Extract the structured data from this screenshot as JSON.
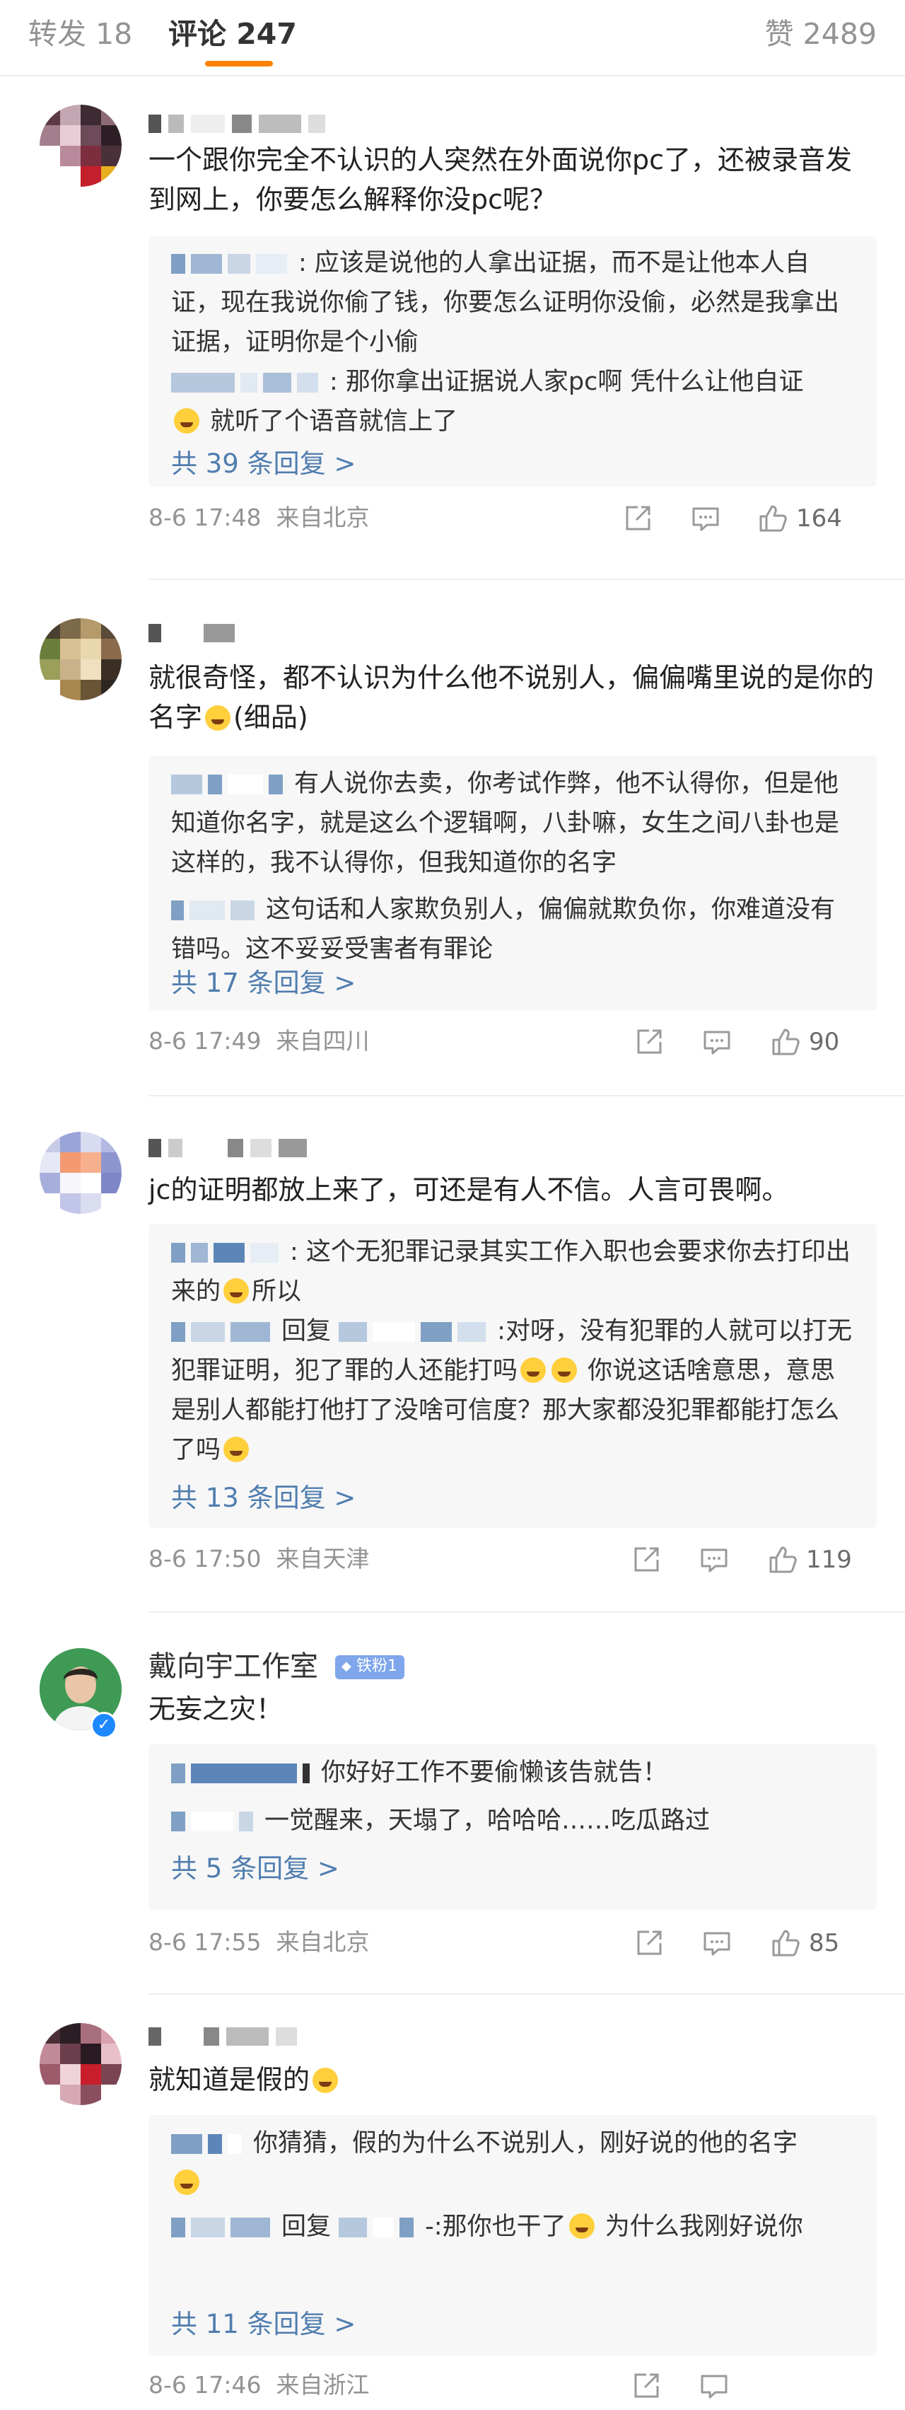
{
  "tabs": {
    "repost": "转发 18",
    "comments": "评论 247",
    "likes": "赞 2489"
  },
  "colors": {
    "accent": "#ff8200",
    "link": "#507daf",
    "muted": "#939393",
    "reply_bg": "#f7f7f7",
    "verified": "#1e88ff"
  },
  "comments": [
    {
      "text": "一个跟你完全不认识的人突然在外面说你pc了，还被录音发到网上，你要怎么解释你没pc呢？",
      "replies": [
        ": 应该是说他的人拿出证据，而不是让他本人自证，现在我说你偷了钱，你要怎么证明你没偷，必然是我拿出证据，证明你是个小偷",
        ": 那你拿出证据说人家pc啊 凭什么让他自证",
        " 就听了个语音就信上了"
      ],
      "more": "共 39 条回复 >",
      "time": "8-6 17:48",
      "location": "来自北京",
      "likes": "164"
    },
    {
      "text": "就很奇怪，都不认识为什么他不说别人，偏偏嘴里说的是你的名字",
      "text_suffix": "(细品)",
      "replies": [
        "有人说你去卖，你考试作弊，他不认得你，但是他知道你名字，就是这么个逻辑啊，八卦嘛，女生之间八卦也是这样的，我不认得你，但我知道你的名字",
        "这句话和人家欺负别人，偏偏就欺负你，你难道没有错吗。这不妥妥受害者有罪论"
      ],
      "more": "共 17 条回复 >",
      "time": "8-6 17:49",
      "location": "来自四川",
      "likes": "90"
    },
    {
      "text": "jc的证明都放上来了，可还是有人不信。人言可畏啊。",
      "replies": [
        ": 这个无犯罪记录其实工作入职也会要求你去打印出来的",
        "所以",
        "回复",
        ":对呀，没有犯罪的人就可以打无犯罪证明，犯了罪的人还能打吗",
        " 你说这话啥意思，意思是别人都能打他打了没啥可信度？那大家都没犯罪都能打怎么了吗"
      ],
      "more": "共 13 条回复 >",
      "time": "8-6 17:50",
      "location": "来自天津",
      "likes": "119"
    },
    {
      "name": "戴向宇工作室",
      "badge": "铁粉1",
      "text": "无妄之灾！",
      "replies": [
        "你好好工作不要偷懒该告就告！",
        "一觉醒来，天塌了，哈哈哈……吃瓜路过"
      ],
      "more": "共 5 条回复 >",
      "time": "8-6 17:55",
      "location": "来自北京",
      "likes": "85"
    },
    {
      "text": "就知道是假的",
      "replies": [
        "你猜猜，假的为什么不说别人，刚好说的他的名字",
        "回复",
        "-:那你也干了",
        " 为什么我刚好说你"
      ],
      "more": "共 11 条回复 >",
      "time": "8-6 17:46",
      "location": "来自浙江"
    }
  ]
}
